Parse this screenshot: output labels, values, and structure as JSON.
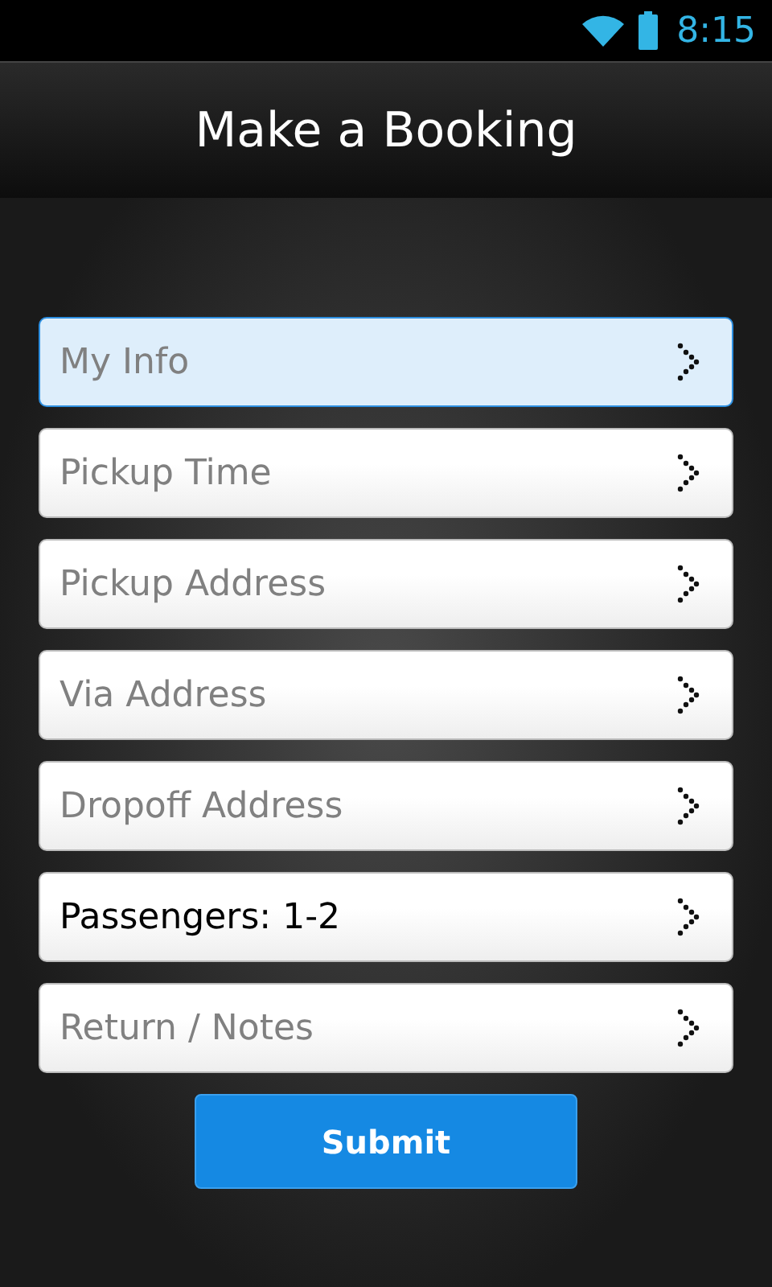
{
  "status_bar": {
    "time": "8:15"
  },
  "header": {
    "title": "Make a Booking"
  },
  "items": [
    {
      "label": "My Info",
      "selected": true,
      "filled": false
    },
    {
      "label": "Pickup Time",
      "selected": false,
      "filled": false
    },
    {
      "label": "Pickup Address",
      "selected": false,
      "filled": false
    },
    {
      "label": "Via Address",
      "selected": false,
      "filled": false
    },
    {
      "label": "Dropoff Address",
      "selected": false,
      "filled": false
    },
    {
      "label": "Passengers: 1-2",
      "selected": false,
      "filled": true
    },
    {
      "label": "Return / Notes",
      "selected": false,
      "filled": false
    }
  ],
  "submit": {
    "label": "Submit"
  }
}
